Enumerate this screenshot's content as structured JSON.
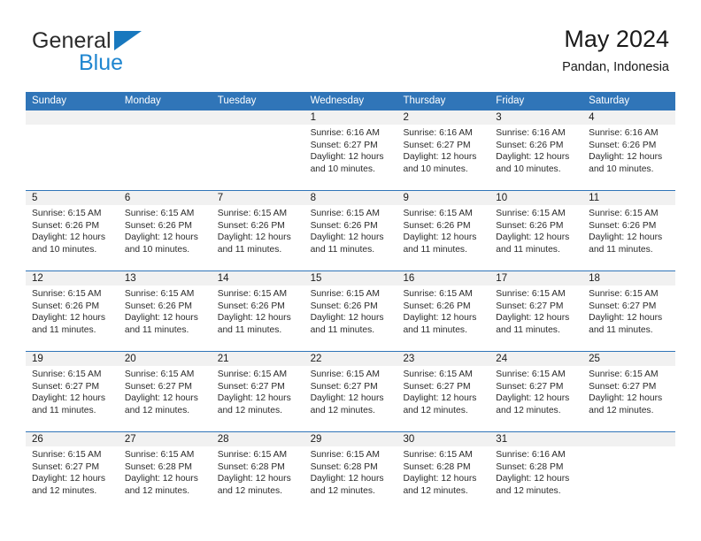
{
  "brand": {
    "name_dark": "General",
    "name_blue": "Blue",
    "logo_blue": "#1878be",
    "text_blue": "#1f86d0"
  },
  "header": {
    "title": "May 2024",
    "subtitle": "Pandan, Indonesia"
  },
  "theme": {
    "header_blue": "#3075b8",
    "numbar_gray": "#f1f1f1"
  },
  "weekdays": [
    "Sunday",
    "Monday",
    "Tuesday",
    "Wednesday",
    "Thursday",
    "Friday",
    "Saturday"
  ],
  "weeks": [
    [
      {
        "day": "",
        "sunrise": "",
        "sunset": "",
        "daylight1": "",
        "daylight2": ""
      },
      {
        "day": "",
        "sunrise": "",
        "sunset": "",
        "daylight1": "",
        "daylight2": ""
      },
      {
        "day": "",
        "sunrise": "",
        "sunset": "",
        "daylight1": "",
        "daylight2": ""
      },
      {
        "day": "1",
        "sunrise": "Sunrise: 6:16 AM",
        "sunset": "Sunset: 6:27 PM",
        "daylight1": "Daylight: 12 hours",
        "daylight2": "and 10 minutes."
      },
      {
        "day": "2",
        "sunrise": "Sunrise: 6:16 AM",
        "sunset": "Sunset: 6:27 PM",
        "daylight1": "Daylight: 12 hours",
        "daylight2": "and 10 minutes."
      },
      {
        "day": "3",
        "sunrise": "Sunrise: 6:16 AM",
        "sunset": "Sunset: 6:26 PM",
        "daylight1": "Daylight: 12 hours",
        "daylight2": "and 10 minutes."
      },
      {
        "day": "4",
        "sunrise": "Sunrise: 6:16 AM",
        "sunset": "Sunset: 6:26 PM",
        "daylight1": "Daylight: 12 hours",
        "daylight2": "and 10 minutes."
      }
    ],
    [
      {
        "day": "5",
        "sunrise": "Sunrise: 6:15 AM",
        "sunset": "Sunset: 6:26 PM",
        "daylight1": "Daylight: 12 hours",
        "daylight2": "and 10 minutes."
      },
      {
        "day": "6",
        "sunrise": "Sunrise: 6:15 AM",
        "sunset": "Sunset: 6:26 PM",
        "daylight1": "Daylight: 12 hours",
        "daylight2": "and 10 minutes."
      },
      {
        "day": "7",
        "sunrise": "Sunrise: 6:15 AM",
        "sunset": "Sunset: 6:26 PM",
        "daylight1": "Daylight: 12 hours",
        "daylight2": "and 11 minutes."
      },
      {
        "day": "8",
        "sunrise": "Sunrise: 6:15 AM",
        "sunset": "Sunset: 6:26 PM",
        "daylight1": "Daylight: 12 hours",
        "daylight2": "and 11 minutes."
      },
      {
        "day": "9",
        "sunrise": "Sunrise: 6:15 AM",
        "sunset": "Sunset: 6:26 PM",
        "daylight1": "Daylight: 12 hours",
        "daylight2": "and 11 minutes."
      },
      {
        "day": "10",
        "sunrise": "Sunrise: 6:15 AM",
        "sunset": "Sunset: 6:26 PM",
        "daylight1": "Daylight: 12 hours",
        "daylight2": "and 11 minutes."
      },
      {
        "day": "11",
        "sunrise": "Sunrise: 6:15 AM",
        "sunset": "Sunset: 6:26 PM",
        "daylight1": "Daylight: 12 hours",
        "daylight2": "and 11 minutes."
      }
    ],
    [
      {
        "day": "12",
        "sunrise": "Sunrise: 6:15 AM",
        "sunset": "Sunset: 6:26 PM",
        "daylight1": "Daylight: 12 hours",
        "daylight2": "and 11 minutes."
      },
      {
        "day": "13",
        "sunrise": "Sunrise: 6:15 AM",
        "sunset": "Sunset: 6:26 PM",
        "daylight1": "Daylight: 12 hours",
        "daylight2": "and 11 minutes."
      },
      {
        "day": "14",
        "sunrise": "Sunrise: 6:15 AM",
        "sunset": "Sunset: 6:26 PM",
        "daylight1": "Daylight: 12 hours",
        "daylight2": "and 11 minutes."
      },
      {
        "day": "15",
        "sunrise": "Sunrise: 6:15 AM",
        "sunset": "Sunset: 6:26 PM",
        "daylight1": "Daylight: 12 hours",
        "daylight2": "and 11 minutes."
      },
      {
        "day": "16",
        "sunrise": "Sunrise: 6:15 AM",
        "sunset": "Sunset: 6:26 PM",
        "daylight1": "Daylight: 12 hours",
        "daylight2": "and 11 minutes."
      },
      {
        "day": "17",
        "sunrise": "Sunrise: 6:15 AM",
        "sunset": "Sunset: 6:27 PM",
        "daylight1": "Daylight: 12 hours",
        "daylight2": "and 11 minutes."
      },
      {
        "day": "18",
        "sunrise": "Sunrise: 6:15 AM",
        "sunset": "Sunset: 6:27 PM",
        "daylight1": "Daylight: 12 hours",
        "daylight2": "and 11 minutes."
      }
    ],
    [
      {
        "day": "19",
        "sunrise": "Sunrise: 6:15 AM",
        "sunset": "Sunset: 6:27 PM",
        "daylight1": "Daylight: 12 hours",
        "daylight2": "and 11 minutes."
      },
      {
        "day": "20",
        "sunrise": "Sunrise: 6:15 AM",
        "sunset": "Sunset: 6:27 PM",
        "daylight1": "Daylight: 12 hours",
        "daylight2": "and 12 minutes."
      },
      {
        "day": "21",
        "sunrise": "Sunrise: 6:15 AM",
        "sunset": "Sunset: 6:27 PM",
        "daylight1": "Daylight: 12 hours",
        "daylight2": "and 12 minutes."
      },
      {
        "day": "22",
        "sunrise": "Sunrise: 6:15 AM",
        "sunset": "Sunset: 6:27 PM",
        "daylight1": "Daylight: 12 hours",
        "daylight2": "and 12 minutes."
      },
      {
        "day": "23",
        "sunrise": "Sunrise: 6:15 AM",
        "sunset": "Sunset: 6:27 PM",
        "daylight1": "Daylight: 12 hours",
        "daylight2": "and 12 minutes."
      },
      {
        "day": "24",
        "sunrise": "Sunrise: 6:15 AM",
        "sunset": "Sunset: 6:27 PM",
        "daylight1": "Daylight: 12 hours",
        "daylight2": "and 12 minutes."
      },
      {
        "day": "25",
        "sunrise": "Sunrise: 6:15 AM",
        "sunset": "Sunset: 6:27 PM",
        "daylight1": "Daylight: 12 hours",
        "daylight2": "and 12 minutes."
      }
    ],
    [
      {
        "day": "26",
        "sunrise": "Sunrise: 6:15 AM",
        "sunset": "Sunset: 6:27 PM",
        "daylight1": "Daylight: 12 hours",
        "daylight2": "and 12 minutes."
      },
      {
        "day": "27",
        "sunrise": "Sunrise: 6:15 AM",
        "sunset": "Sunset: 6:28 PM",
        "daylight1": "Daylight: 12 hours",
        "daylight2": "and 12 minutes."
      },
      {
        "day": "28",
        "sunrise": "Sunrise: 6:15 AM",
        "sunset": "Sunset: 6:28 PM",
        "daylight1": "Daylight: 12 hours",
        "daylight2": "and 12 minutes."
      },
      {
        "day": "29",
        "sunrise": "Sunrise: 6:15 AM",
        "sunset": "Sunset: 6:28 PM",
        "daylight1": "Daylight: 12 hours",
        "daylight2": "and 12 minutes."
      },
      {
        "day": "30",
        "sunrise": "Sunrise: 6:15 AM",
        "sunset": "Sunset: 6:28 PM",
        "daylight1": "Daylight: 12 hours",
        "daylight2": "and 12 minutes."
      },
      {
        "day": "31",
        "sunrise": "Sunrise: 6:16 AM",
        "sunset": "Sunset: 6:28 PM",
        "daylight1": "Daylight: 12 hours",
        "daylight2": "and 12 minutes."
      },
      {
        "day": "",
        "sunrise": "",
        "sunset": "",
        "daylight1": "",
        "daylight2": ""
      }
    ]
  ]
}
